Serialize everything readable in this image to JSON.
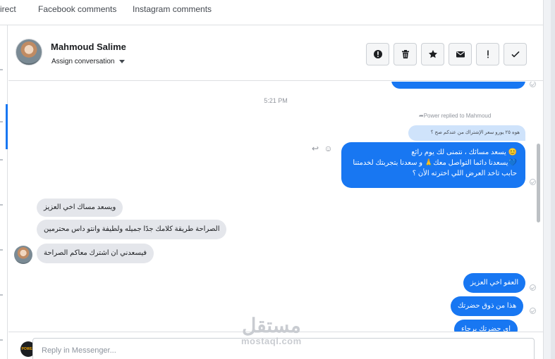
{
  "tabs": [
    {
      "label": "irect"
    },
    {
      "label": "Facebook comments"
    },
    {
      "label": "Instagram comments"
    }
  ],
  "header": {
    "contact_name": "Mahmoud Salime",
    "assign_label": "Assign conversation",
    "actions": [
      {
        "icon": "alert-circle-icon"
      },
      {
        "icon": "trash-icon"
      },
      {
        "icon": "star-icon"
      },
      {
        "icon": "envelope-icon"
      },
      {
        "icon": "exclamation-icon"
      },
      {
        "icon": "check-icon"
      }
    ]
  },
  "conversation": {
    "timestamp": "5:21 PM",
    "reply_note": "Power replied to Mahmoud",
    "quoted_text": "هوه ٢٥ يورو سعر الإشتراك من عندكم صح ؟",
    "outgoing_reply": {
      "line1": "😊 يسعد مسائك ، نتمنى لك يوم رائع",
      "line2": "💙يسعدنا دائما التواصل معك🙏 و سعدنا بتجربتك لخدمتنا",
      "line3": "حابب تاخد العرض اللي اخترته الأن ؟"
    },
    "incoming": [
      {
        "text": "ويسعد مساك اخي العزيز"
      },
      {
        "text": "الصراحة طريقة كلامك جدًا جميله ولطيفة وانتو داس محترمين"
      },
      {
        "text": "فيسعدني ان اشترك معاكم الصراحة"
      }
    ],
    "outgoing_later": [
      {
        "text": "العفو اخي العزيز"
      },
      {
        "text": "هذا من ذوق حضرتك"
      },
      {
        "text": "اي حضرتك يرجاء"
      }
    ]
  },
  "composer": {
    "placeholder": "Reply in Messenger...",
    "page_logo_text": "POWER"
  },
  "watermark": {
    "arabic": "مستقل",
    "latin": "mostaql.com"
  },
  "colors": {
    "accent": "#1877f2",
    "incoming_bubble": "#e4e6eb",
    "quote_bubble": "#cfe3fb"
  }
}
